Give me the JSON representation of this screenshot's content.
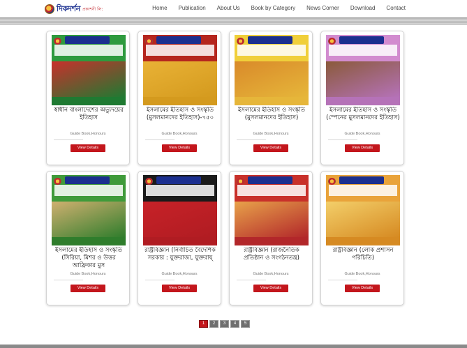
{
  "site": {
    "logo_text": "দিকদর্শন",
    "logo_sub": "প্রকাশনী লি:"
  },
  "nav": [
    "Home",
    "Publication",
    "About Us",
    "Book by Category",
    "News Corner",
    "Download",
    "Contact"
  ],
  "books": [
    {
      "title": "স্বাধীন বাংলাদেশের অভ্যুদয়ের ইতিহাস",
      "category": "Guide Book,Honours",
      "button": "View Details",
      "colors": {
        "top": "#2e9a3e",
        "art": "#c9302c",
        "foot": "#1f7a32"
      }
    },
    {
      "title": "ইসলামের ইতিহাস ও সংস্কৃতি (মুসলমানদের ইতিহাস)-৭৫০",
      "category": "Guide Book,Honours",
      "button": "View Details",
      "colors": {
        "top": "#b5261e",
        "art": "#e9b236",
        "foot": "#d49a1e"
      }
    },
    {
      "title": "ইসলামের ইতিহাস ও সংস্কৃতি (মুসলমানদের ইতিহাস)",
      "category": "Guide Book,Honours",
      "button": "View Details",
      "colors": {
        "top": "#f0cf3a",
        "art": "#d98a2a",
        "foot": "#e6b63a"
      }
    },
    {
      "title": "ইসলামের ইতিহাস ও সংস্কৃতি (স্পেনের মুসলমানদের ইতিহাস)",
      "category": "Guide Book,Honours",
      "button": "View Details",
      "colors": {
        "top": "#d28ccf",
        "art": "#8a5a3a",
        "foot": "#b572b8"
      }
    },
    {
      "title": "ইসলামের ইতিহাস ও সংস্কৃতি (সিরিয়া, মিশর ও উত্তর আফ্রিকার মুস",
      "category": "Guide Book,Honours",
      "button": "View Details",
      "colors": {
        "top": "#3f9a3a",
        "art": "#d0b070",
        "foot": "#2f7d2c"
      }
    },
    {
      "title": "রাষ্ট্রবিজ্ঞান (নির্বাচিত বৈদেশিক সরকার : যুক্তরাজ্য, যুক্তরাষ্",
      "category": "Guide Book,Honours",
      "button": "View Details",
      "colors": {
        "top": "#1a1a1a",
        "art": "#c72228",
        "foot": "#b01c22"
      }
    },
    {
      "title": "রাষ্ট্রবিজ্ঞান (রাজনৈতিক প্রতিষ্ঠান ও সংগঠনতন্ত্র)",
      "category": "Guide Book,Honours",
      "button": "View Details",
      "colors": {
        "top": "#c8302a",
        "art": "#e8a24a",
        "foot": "#b2272a"
      }
    },
    {
      "title": "রাষ্ট্রবিজ্ঞান (লোক প্রশাসন পরিচিতি)",
      "category": "Guide Book,Honours",
      "button": "View Details",
      "colors": {
        "top": "#e9a33a",
        "art": "#f3cf6a",
        "foot": "#d68a22"
      }
    }
  ],
  "pagination": {
    "pages": [
      "1",
      "2",
      "3",
      "4",
      "5"
    ],
    "active": "1"
  }
}
